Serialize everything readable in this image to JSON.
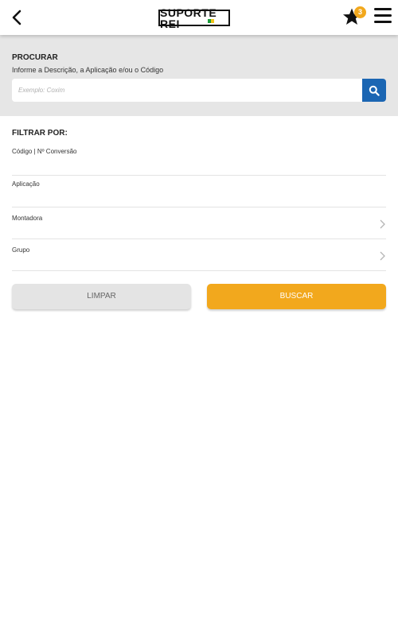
{
  "header": {
    "logo_text": "SUPORTE REI",
    "favorites_count": "3"
  },
  "search": {
    "title": "PROCURAR",
    "subtitle": "Informe a Descrição, a Aplicação e/ou o Código",
    "placeholder": "Exemplo: Coxim"
  },
  "filters": {
    "title": "FILTRAR POR:",
    "items": [
      {
        "label": "Código | Nº Conversão",
        "has_chevron": false
      },
      {
        "label": "Aplicação",
        "has_chevron": false
      },
      {
        "label": "Montadora",
        "has_chevron": true
      },
      {
        "label": "Grupo",
        "has_chevron": true
      }
    ]
  },
  "actions": {
    "clear_label": "LIMPAR",
    "search_label": "BUSCAR"
  },
  "colors": {
    "accent": "#f2a81d",
    "search_button": "#1b66b3",
    "panel_bg": "#e6e6e6"
  },
  "icons": [
    "back-arrow-icon",
    "star-icon",
    "hamburger-menu-icon",
    "search-icon",
    "chevron-right-icon"
  ]
}
